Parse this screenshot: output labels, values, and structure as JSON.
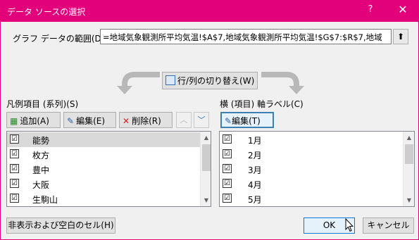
{
  "window": {
    "title": "データ ソースの選択",
    "help_label": "?",
    "close_label": "✕",
    "accent_color": "#e3007b"
  },
  "range": {
    "label": "グラフ データの範囲(D):",
    "value": "=地域気象観測所平均気温!$A$7,地域気象観測所平均気温!$G$7:$R$7,地域",
    "collapse_label": "⬆"
  },
  "swap": {
    "label": "行/列の切り替え(W)"
  },
  "legend": {
    "label": "凡例項目 (系列)(S)",
    "add_label": "追加(A)",
    "edit_label": "編集(E)",
    "delete_label": "削除(R)",
    "up_label": "︿",
    "down_label": "﹀",
    "items": [
      {
        "label": "能勢",
        "checked": "☑"
      },
      {
        "label": "枚方",
        "checked": "☑"
      },
      {
        "label": "豊中",
        "checked": "☑"
      },
      {
        "label": "大阪",
        "checked": "☑"
      },
      {
        "label": "生駒山",
        "checked": "☑"
      }
    ]
  },
  "axis": {
    "label": "横 (項目) 軸ラベル(C)",
    "edit_label": "編集(T)",
    "items": [
      {
        "label": "1月",
        "checked": "☑"
      },
      {
        "label": "2月",
        "checked": "☑"
      },
      {
        "label": "3月",
        "checked": "☑"
      },
      {
        "label": "4月",
        "checked": "☑"
      },
      {
        "label": "5月",
        "checked": "☑"
      }
    ]
  },
  "buttons": {
    "hidden_cells": "非表示および空白のセル(H)",
    "ok": "OK",
    "cancel": "キャンセル"
  }
}
